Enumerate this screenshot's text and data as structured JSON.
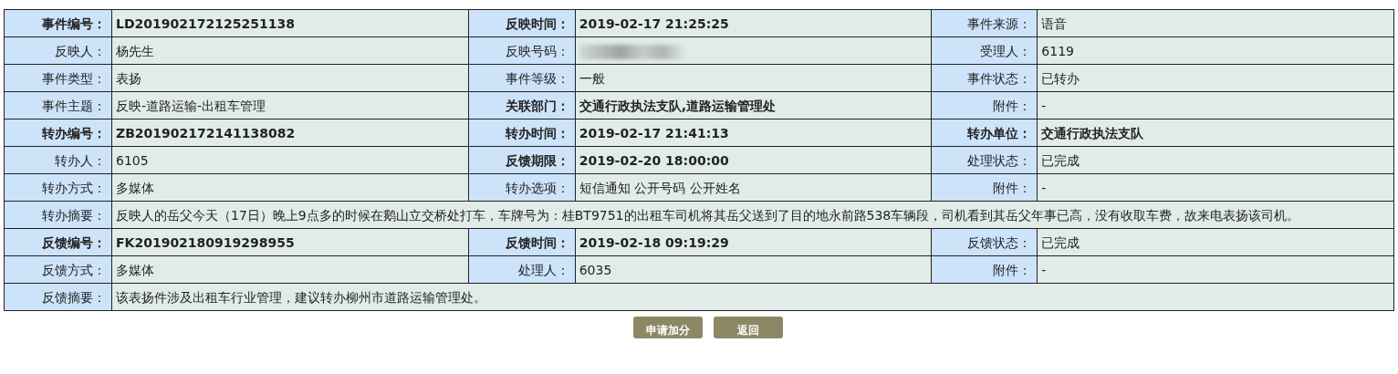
{
  "rows": [
    {
      "kind": "triple",
      "cells": [
        {
          "label": "事件编号：",
          "value": "LD201902172125251138",
          "bold": true
        },
        {
          "label": "反映时间：",
          "value": "2019-02-17 21:25:25",
          "bold": true
        },
        {
          "label": "事件来源：",
          "value": "语音",
          "bold": false
        }
      ]
    },
    {
      "kind": "triple",
      "cells": [
        {
          "label": "反映人：",
          "value": "杨先生",
          "bold": false
        },
        {
          "label": "反映号码：",
          "redacted": true,
          "bold": false
        },
        {
          "label": "受理人：",
          "value": "6119",
          "bold": false
        }
      ]
    },
    {
      "kind": "triple",
      "cells": [
        {
          "label": "事件类型：",
          "value": "表扬",
          "bold": false
        },
        {
          "label": "事件等级：",
          "value": "一般",
          "bold": false
        },
        {
          "label": "事件状态：",
          "value": "已转办",
          "bold": false
        }
      ]
    },
    {
      "kind": "triple",
      "cells": [
        {
          "label": "事件主题：",
          "value": "反映-道路运输-出租车管理",
          "bold": false
        },
        {
          "label": "关联部门：",
          "value": "交通行政执法支队,道路运输管理处",
          "bold": true
        },
        {
          "label": "附件：",
          "value": "-",
          "bold": false
        }
      ]
    },
    {
      "kind": "triple",
      "cells": [
        {
          "label": "转办编号：",
          "value": "ZB201902172141138082",
          "bold": true
        },
        {
          "label": "转办时间：",
          "value": "2019-02-17 21:41:13",
          "bold": true
        },
        {
          "label": "转办单位：",
          "value": "交通行政执法支队",
          "bold": true
        }
      ]
    },
    {
      "kind": "triple",
      "cells": [
        {
          "label": "转办人：",
          "value": "6105",
          "bold": false
        },
        {
          "label": "反馈期限：",
          "value": "2019-02-20 18:00:00",
          "bold": true
        },
        {
          "label": "处理状态：",
          "value": "已完成",
          "bold": false
        }
      ]
    },
    {
      "kind": "triple",
      "cells": [
        {
          "label": "转办方式：",
          "value": "多媒体",
          "bold": false
        },
        {
          "label": "转办选项：",
          "value": "短信通知 公开号码 公开姓名",
          "bold": false
        },
        {
          "label": "附件：",
          "value": "-",
          "bold": false
        }
      ]
    },
    {
      "kind": "wide",
      "cells": [
        {
          "label": "转办摘要：",
          "value": "反映人的岳父今天（17日）晚上9点多的时候在鹅山立交桥处打车，车牌号为：桂BT9751的出租车司机将其岳父送到了目的地永前路538车辆段，司机看到其岳父年事已高，没有收取车费，故来电表扬该司机。",
          "bold": false
        }
      ]
    },
    {
      "kind": "triple",
      "cells": [
        {
          "label": "反馈编号：",
          "value": "FK201902180919298955",
          "bold": true
        },
        {
          "label": "反馈时间：",
          "value": "2019-02-18 09:19:29",
          "bold": true
        },
        {
          "label": "反馈状态：",
          "value": "已完成",
          "bold": false
        }
      ]
    },
    {
      "kind": "triple",
      "cells": [
        {
          "label": "反馈方式：",
          "value": "多媒体",
          "bold": false
        },
        {
          "label": "处理人：",
          "value": "6035",
          "bold": false
        },
        {
          "label": "附件：",
          "value": "-",
          "bold": false
        }
      ]
    },
    {
      "kind": "wide",
      "cells": [
        {
          "label": "反馈摘要：",
          "value": "该表扬件涉及出租车行业管理，建议转办柳州市道路运输管理处。",
          "bold": false
        }
      ]
    }
  ],
  "buttons": [
    "申请加分",
    "返回"
  ]
}
